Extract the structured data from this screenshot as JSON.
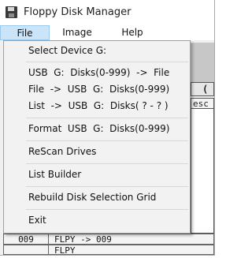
{
  "window": {
    "title": "Floppy Disk Manager"
  },
  "menubar": {
    "items": [
      {
        "label": "File",
        "active": true
      },
      {
        "label": "Image",
        "active": false
      },
      {
        "label": "Help",
        "active": false
      }
    ]
  },
  "file_menu": {
    "items": [
      {
        "label": "Select Device G:"
      },
      {
        "label": "USB  G:  Disks(0-999)  ->  File"
      },
      {
        "label": "File  ->  USB  G:  Disks(0-999)"
      },
      {
        "label": "List  ->  USB  G:  Disks( ? - ? )"
      },
      {
        "label": "Format  USB  G:  Disks(0-999)"
      },
      {
        "label": "ReScan Drives"
      },
      {
        "label": "List Builder"
      },
      {
        "label": "Rebuild Disk Selection Grid"
      },
      {
        "label": "Exit"
      }
    ]
  },
  "background": {
    "peek_paren": "(",
    "peek_header": "esc",
    "rows": [
      {
        "num": "009",
        "desc": "FLPY -> 009"
      },
      {
        "num": "",
        "desc": "FLPY"
      }
    ]
  },
  "colors": {
    "menu_highlight": "#cce4f7",
    "menu_highlight_border": "#99c9ef",
    "background_strip": "#c7c7c7"
  }
}
